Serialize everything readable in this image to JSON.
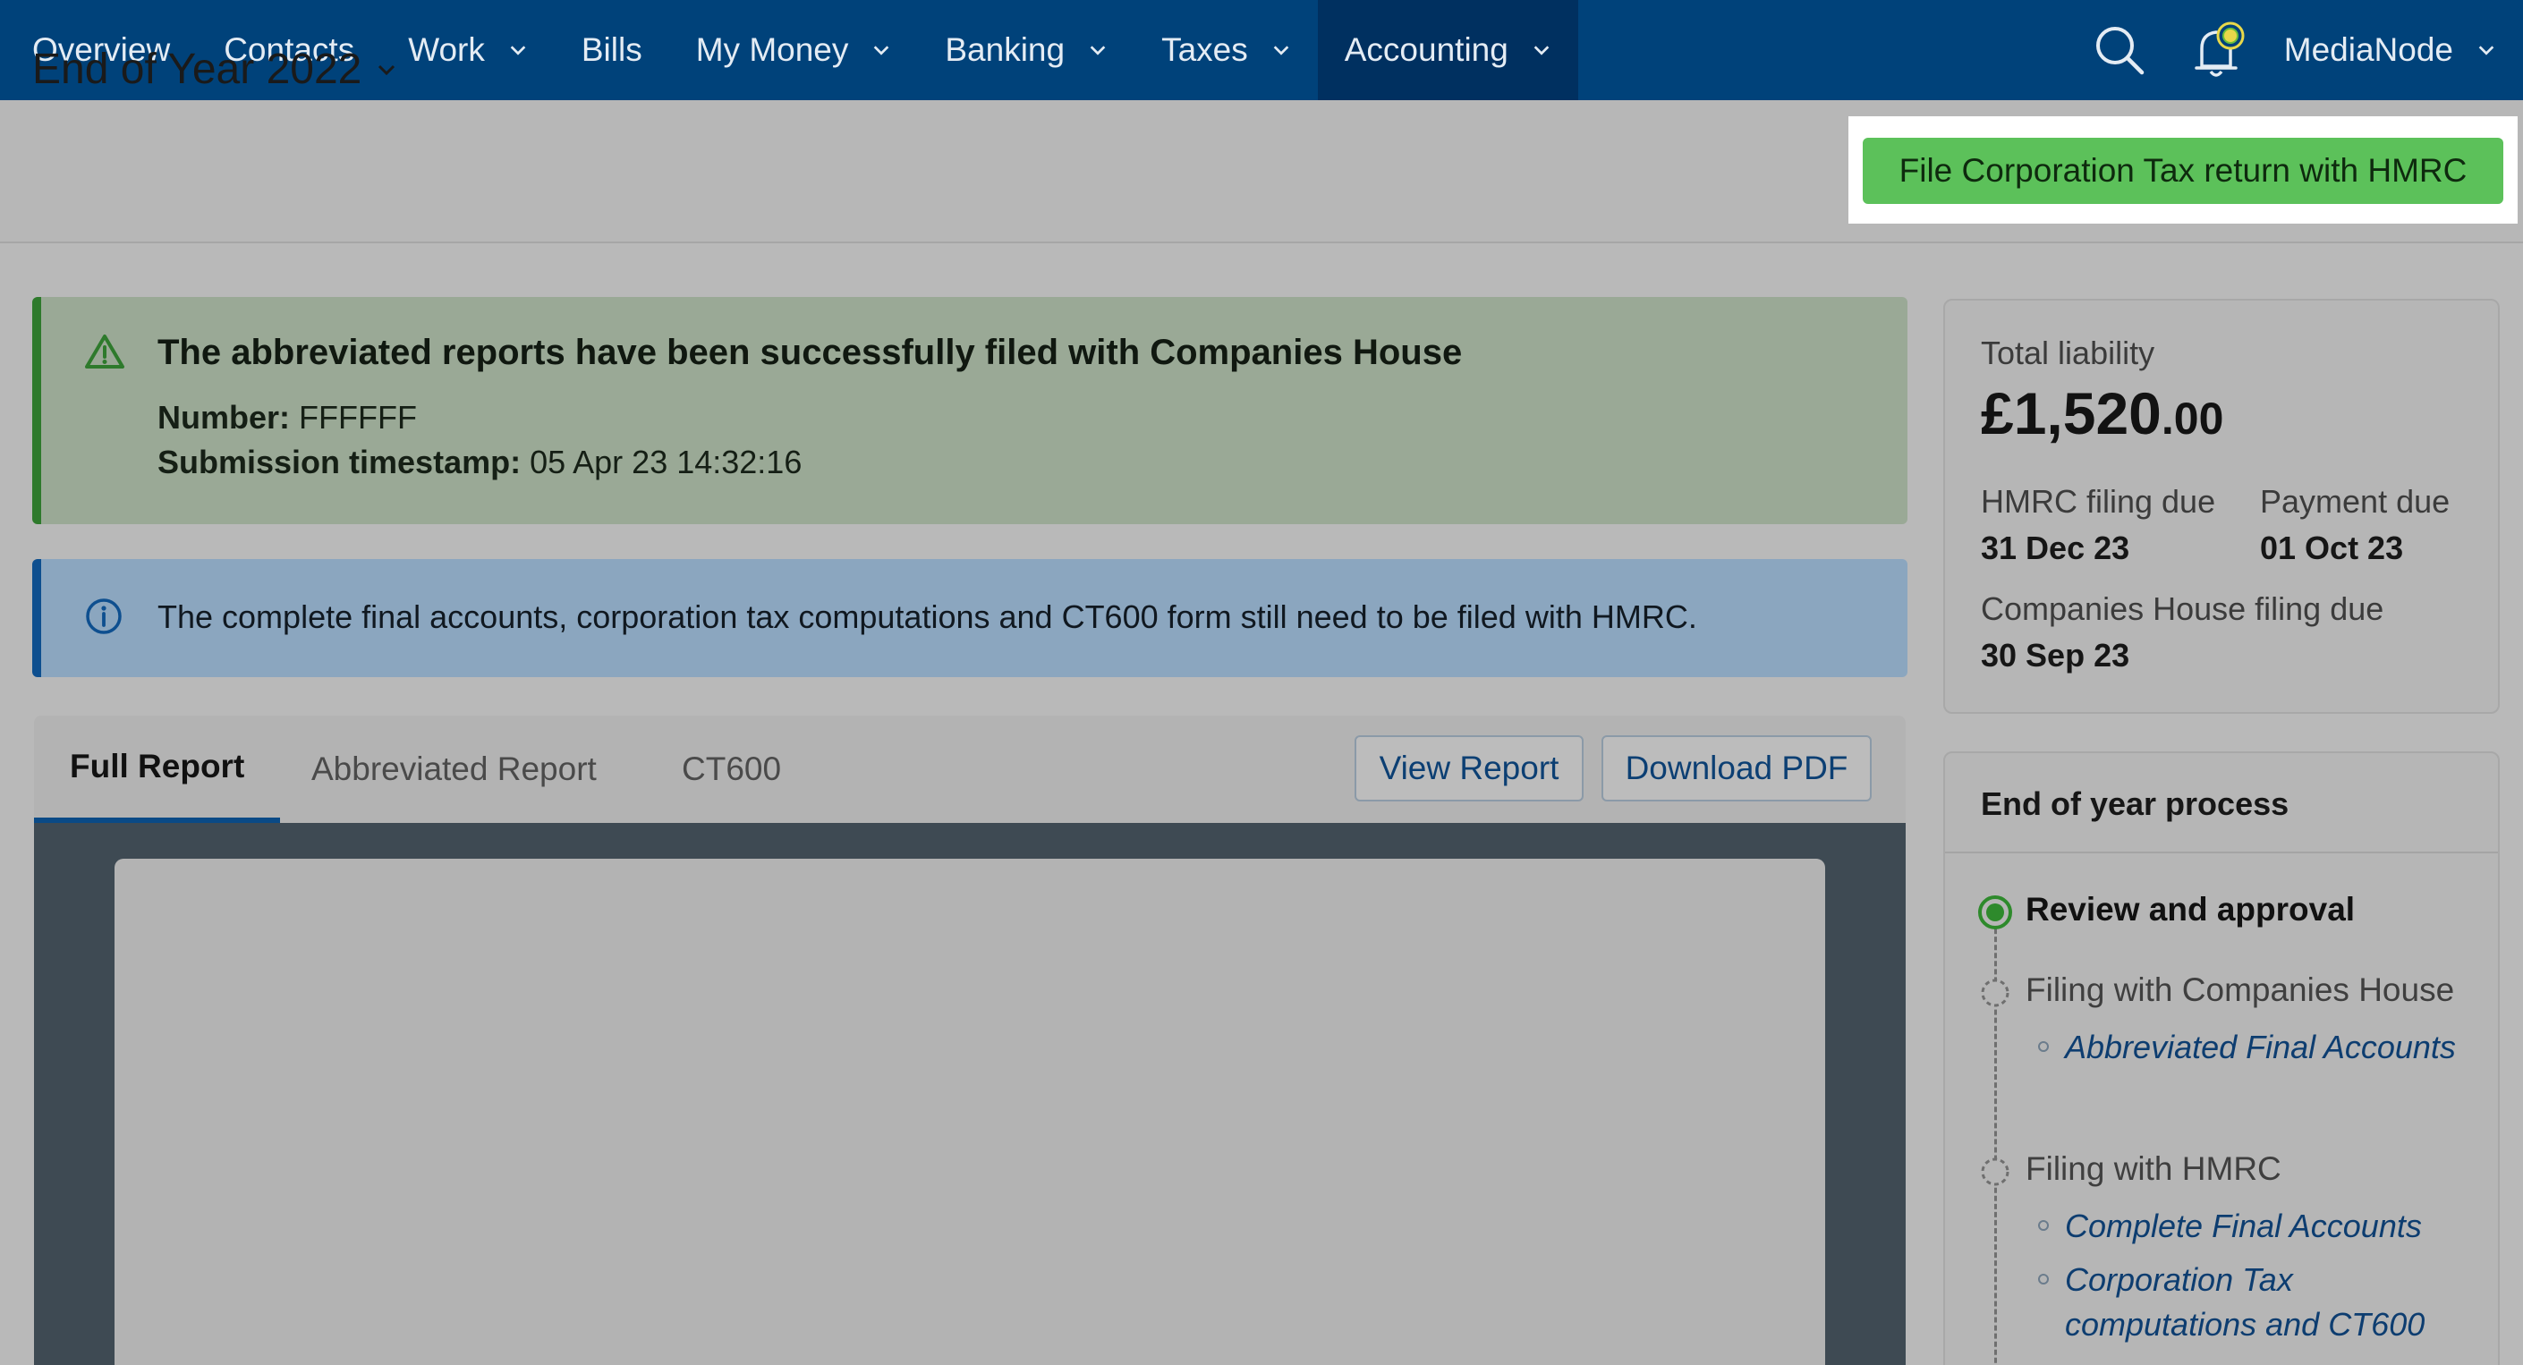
{
  "nav": {
    "items": [
      {
        "label": "Overview",
        "dropdown": false
      },
      {
        "label": "Contacts",
        "dropdown": false
      },
      {
        "label": "Work",
        "dropdown": true
      },
      {
        "label": "Bills",
        "dropdown": false
      },
      {
        "label": "My Money",
        "dropdown": true
      },
      {
        "label": "Banking",
        "dropdown": true
      },
      {
        "label": "Taxes",
        "dropdown": true
      },
      {
        "label": "Accounting",
        "dropdown": true,
        "active": true
      }
    ],
    "search_icon": "search-icon",
    "notification_icon": "bell-icon",
    "user_name": "MediaNode"
  },
  "header": {
    "title": "End of Year 2022",
    "primary_button": "File Corporation Tax return with HMRC"
  },
  "alerts": {
    "success": {
      "title": "The abbreviated reports have been successfully filed with Companies House",
      "number_label": "Number:",
      "number_value": "FFFFFF",
      "timestamp_label": "Submission timestamp:",
      "timestamp_value": "05 Apr 23 14:32:16"
    },
    "info": {
      "text": "The complete final accounts, corporation tax computations and CT600 form still need to be filed with HMRC."
    }
  },
  "report": {
    "tabs": [
      "Full Report",
      "Abbreviated Report",
      "CT600"
    ],
    "active_tab": "Full Report",
    "view_button": "View Report",
    "download_button": "Download PDF"
  },
  "liability": {
    "label": "Total liability",
    "amount_main": "£1,520",
    "amount_decimal": ".00",
    "hmrc_due_label": "HMRC filing due",
    "hmrc_due_value": "31 Dec 23",
    "payment_due_label": "Payment due",
    "payment_due_value": "01 Oct 23",
    "ch_due_label": "Companies House filing due",
    "ch_due_value": "30 Sep 23"
  },
  "process": {
    "title": "End of year process",
    "step1": "Review and approval",
    "step2": "Filing with Companies House",
    "step2_links": [
      "Abbreviated Final Accounts"
    ],
    "step3": "Filing with HMRC",
    "step3_links": [
      "Complete Final Accounts",
      "Corporation Tax computations and CT600"
    ]
  },
  "colors": {
    "nav_bg": "#00427a",
    "primary_button": "#5cc15a",
    "success_accent": "#2e7a2c",
    "info_accent": "#0e4f8f"
  }
}
